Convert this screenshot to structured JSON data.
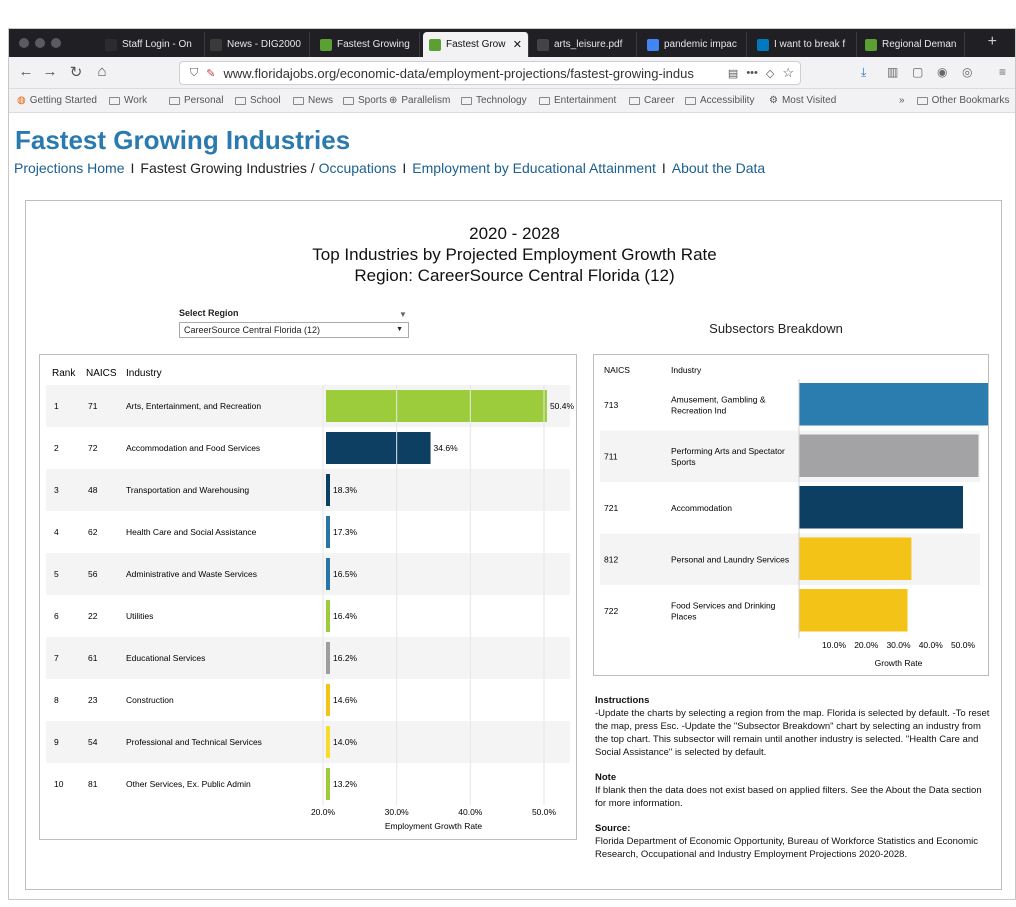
{
  "browser": {
    "tabs": [
      {
        "label": "Staff Login - On",
        "icon": "spc-favicon",
        "color": "#2c2c2c"
      },
      {
        "label": "News - DIG2000",
        "icon": "mc-favicon",
        "color": "#3a3a3a"
      },
      {
        "label": "Fastest Growing",
        "icon": "floridajobs-favicon",
        "color": "#5aa032"
      },
      {
        "label": "Fastest Grow",
        "icon": "floridajobs-favicon",
        "color": "#5aa032",
        "active": true
      },
      {
        "label": "arts_leisure.pdf",
        "icon": "pdf-icon",
        "color": "#444"
      },
      {
        "label": "pandemic impac",
        "icon": "google-icon",
        "color": "#4285f4"
      },
      {
        "label": "I want to break f",
        "icon": "trello-icon",
        "color": "#0079bf"
      },
      {
        "label": "Regional Deman",
        "icon": "floridajobs-favicon",
        "color": "#5aa032"
      }
    ],
    "url": "www.floridajobs.org/economic-data/employment-projections/fastest-growing-indus",
    "bookmarks": [
      "Getting Started",
      "Work",
      "Personal",
      "School",
      "News",
      "Sports",
      "Parallelism",
      "Technology",
      "Entertainment",
      "Career",
      "Accessibility",
      "Most Visited"
    ],
    "other_bookmarks": "Other Bookmarks"
  },
  "page": {
    "title": "Fastest Growing Industries",
    "nav": {
      "home": "Projections Home",
      "current": "Fastest Growing Industries /",
      "occupations": "Occupations",
      "education": "Employment by Educational Attainment",
      "about": "About the Data",
      "sep": "I"
    },
    "heading_line1": "2020 - 2028",
    "heading_line2": "Top Industries by Projected Employment Growth Rate",
    "heading_line3": "Region: CareerSource Central Florida (12)",
    "region_label": "Select Region",
    "region_value": "CareerSource Central Florida (12)",
    "subsectors_title": "Subsectors Breakdown",
    "instructions_title": "Instructions",
    "instructions": "-Update the charts by selecting a region from the map. Florida is selected by default. -To reset the map, press Esc. -Update the \"Subsector Breakdown\" chart by selecting an industry from the top chart. This subsector will remain until another industry is selected. \"Health Care and Social Assistance\" is selected by default.",
    "note_title": "Note",
    "note": "If blank then the data does not exist based on applied filters. See the About the Data section for more information.",
    "source_title": "Source:",
    "source": "Florida Department of Economic Opportunity, Bureau of Workforce Statistics and Economic Research, Occupational and Industry Employment Projections 2020-2028."
  },
  "chart_data": [
    {
      "type": "bar",
      "orientation": "horizontal",
      "columns": [
        "Rank",
        "NAICS",
        "Industry"
      ],
      "rows": [
        {
          "rank": "1",
          "naics": "71",
          "industry": "Arts, Entertainment, and Recreation",
          "value": 50.4,
          "label": "50.4%",
          "color": "#9ccc3c"
        },
        {
          "rank": "2",
          "naics": "72",
          "industry": "Accommodation and Food Services",
          "value": 34.6,
          "label": "34.6%",
          "color": "#0d3f62"
        },
        {
          "rank": "3",
          "naics": "48",
          "industry": "Transportation and Warehousing",
          "value": 18.3,
          "label": "18.3%",
          "color": "#0d3f62"
        },
        {
          "rank": "4",
          "naics": "62",
          "industry": "Health Care and Social Assistance",
          "value": 17.3,
          "label": "17.3%",
          "color": "#2a75a8"
        },
        {
          "rank": "5",
          "naics": "56",
          "industry": "Administrative and Waste Services",
          "value": 16.5,
          "label": "16.5%",
          "color": "#2a75a8"
        },
        {
          "rank": "6",
          "naics": "22",
          "industry": "Utilities",
          "value": 16.4,
          "label": "16.4%",
          "color": "#9ccc3c"
        },
        {
          "rank": "7",
          "naics": "61",
          "industry": "Educational Services",
          "value": 16.2,
          "label": "16.2%",
          "color": "#9d9da0"
        },
        {
          "rank": "8",
          "naics": "23",
          "industry": "Construction",
          "value": 14.6,
          "label": "14.6%",
          "color": "#f3c318"
        },
        {
          "rank": "9",
          "naics": "54",
          "industry": "Professional and Technical Services",
          "value": 14.0,
          "label": "14.0%",
          "color": "#f5dc2e"
        },
        {
          "rank": "10",
          "naics": "81",
          "industry": "Other Services, Ex. Public Admin",
          "value": 13.2,
          "label": "13.2%",
          "color": "#9ccc3c"
        }
      ],
      "xlim": [
        10,
        55
      ],
      "ticks": [
        20,
        30,
        40,
        50
      ],
      "tick_labels": [
        "20.0%",
        "30.0%",
        "40.0%",
        "50.0%"
      ],
      "xlabel": "Employment Growth Rate"
    },
    {
      "type": "bar",
      "orientation": "horizontal",
      "columns": [
        "NAICS",
        "Industry"
      ],
      "rows": [
        {
          "naics": "713",
          "industry": [
            "Amusement, Gambling &",
            "Recreation Ind"
          ],
          "value": 58.5,
          "color": "#2a7dae"
        },
        {
          "naics": "711",
          "industry": [
            "Performing Arts and Spectator",
            "Sports"
          ],
          "value": 54.8,
          "color": "#a3a3a6"
        },
        {
          "naics": "721",
          "industry": [
            "Accommodation"
          ],
          "value": 50.0,
          "color": "#0d3f62"
        },
        {
          "naics": "812",
          "industry": [
            "Personal and Laundry Services"
          ],
          "value": 34.0,
          "color": "#f3c318"
        },
        {
          "naics": "722",
          "industry": [
            "Food Services and Drinking",
            "Places"
          ],
          "value": 32.8,
          "color": "#f3c318"
        }
      ],
      "xlim": [
        0,
        55
      ],
      "ticks": [
        10,
        20,
        30,
        40,
        50
      ],
      "tick_labels": [
        "10.0%",
        "20.0%",
        "30.0%",
        "40.0%",
        "50.0%"
      ],
      "xlabel": "Growth Rate"
    }
  ]
}
